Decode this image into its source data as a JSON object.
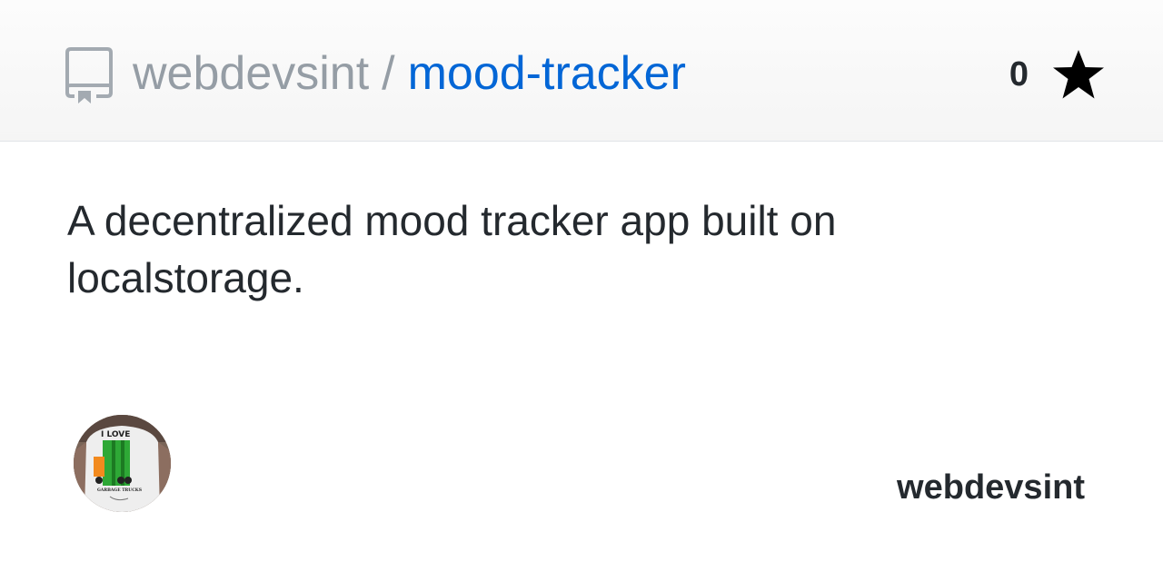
{
  "header": {
    "owner": "webdevsint",
    "separator": "/",
    "repo_name": "mood-tracker",
    "repo_icon": "repo-book-icon",
    "star_count": "0",
    "star_icon": "star-icon"
  },
  "description": "A decentralized mood tracker app built on localstorage.",
  "footer": {
    "avatar_icon": "user-avatar",
    "avatar_shirt_text_top": "I LOVE",
    "avatar_shirt_text_bottom": "GARBAGE TRUCKS",
    "username": "webdevsint"
  },
  "colors": {
    "link": "#0366d6",
    "muted": "#959da5",
    "text": "#24292e"
  }
}
